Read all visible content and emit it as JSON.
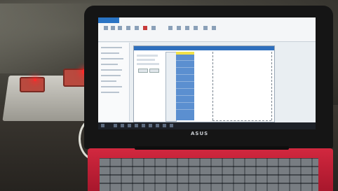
{
  "laptop": {
    "brand": "ASUS"
  }
}
